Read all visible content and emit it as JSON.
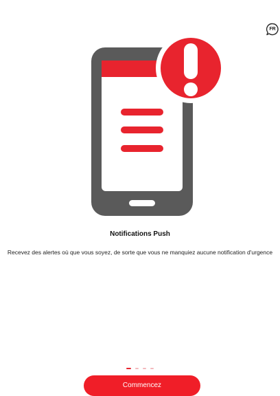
{
  "language": {
    "code": "FR"
  },
  "onboarding": {
    "title": "Notifications Push",
    "description": "Recevez des alertes où que vous soyez, de sorte que vous ne manquiez aucune notification d'urgence",
    "illustration_icon": "phone-alert-icon",
    "current_page": 1,
    "page_count": 4
  },
  "cta": {
    "label": "Commencez"
  },
  "colors": {
    "accent": "#f01e28",
    "phone_body": "#5a5a5a",
    "dot_inactive": "#f3b9bd"
  }
}
